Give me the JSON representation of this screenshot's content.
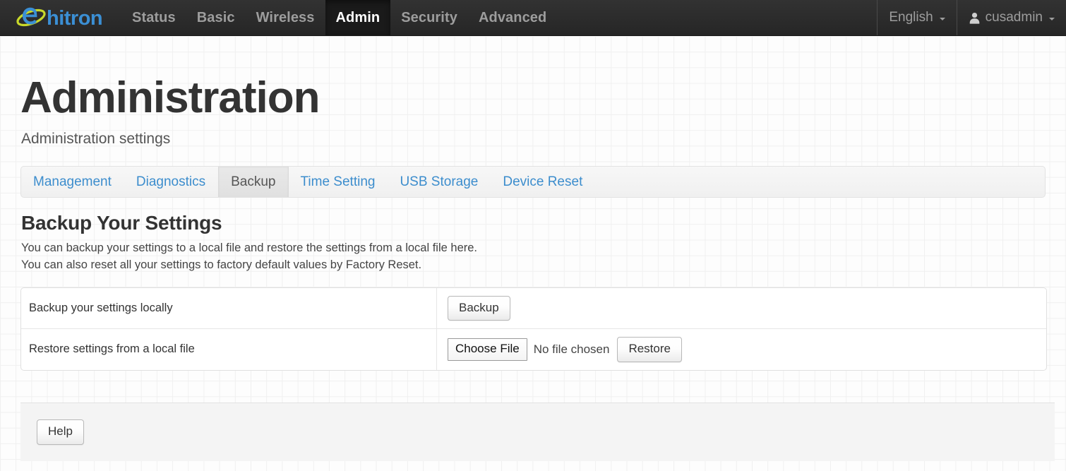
{
  "navbar": {
    "brand": "hitron",
    "items": [
      {
        "label": "Status",
        "active": false
      },
      {
        "label": "Basic",
        "active": false
      },
      {
        "label": "Wireless",
        "active": false
      },
      {
        "label": "Admin",
        "active": true
      },
      {
        "label": "Security",
        "active": false
      },
      {
        "label": "Advanced",
        "active": false
      }
    ],
    "language": "English",
    "user": "cusadmin"
  },
  "page": {
    "title": "Administration",
    "subtitle": "Administration settings"
  },
  "tabs": [
    {
      "label": "Management",
      "active": false
    },
    {
      "label": "Diagnostics",
      "active": false
    },
    {
      "label": "Backup",
      "active": true
    },
    {
      "label": "Time Setting",
      "active": false
    },
    {
      "label": "USB Storage",
      "active": false
    },
    {
      "label": "Device Reset",
      "active": false
    }
  ],
  "section": {
    "title": "Backup Your Settings",
    "desc_line1": "You can backup your settings to a local file and restore the settings from a local file here.",
    "desc_line2": "You can also reset all your settings to factory default values by Factory Reset."
  },
  "table": {
    "rows": [
      {
        "label": "Backup your settings locally",
        "button": "Backup"
      },
      {
        "label": "Restore settings from a local file",
        "file_button": "Choose File",
        "file_status": "No file chosen",
        "button": "Restore"
      }
    ]
  },
  "footer": {
    "help": "Help"
  },
  "colors": {
    "navbar_bg": "#2b2b2b",
    "nav_active_bg": "#1a1a1a",
    "link_blue": "#3c8dcd",
    "brand_blue": "#3b8fd4",
    "brand_swoosh": "#c8d92a",
    "panel_bg": "#f4f4f4"
  }
}
